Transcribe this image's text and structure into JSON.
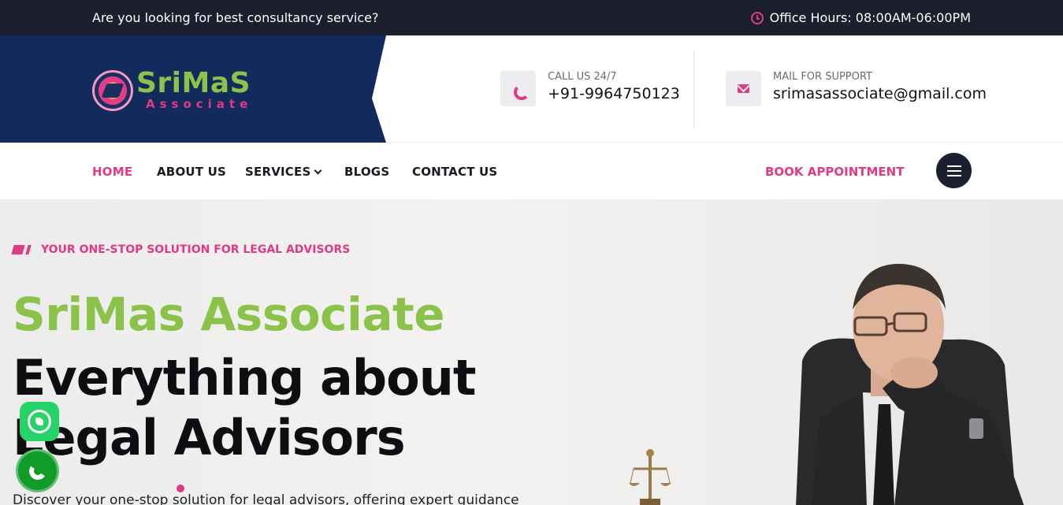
{
  "topbar": {
    "tagline": "Are you looking for best consultancy service?",
    "hours": "Office Hours: 08:00AM-06:00PM",
    "hours_icon": "clock-icon"
  },
  "brand": {
    "name": "SriMaS",
    "sub": "Associate",
    "panel_color": "#132a5c"
  },
  "contacts": {
    "phone": {
      "label": "CALL US 24/7",
      "value": "+91-9964750123",
      "icon": "phone-icon"
    },
    "mail": {
      "label": "MAIL FOR SUPPORT",
      "value": "srimasassociate@gmail.com",
      "icon": "mail-icon"
    }
  },
  "nav": {
    "items": [
      {
        "label": "HOME",
        "active": true
      },
      {
        "label": "ABOUT US"
      },
      {
        "label": "SERVICES",
        "dropdown": true
      },
      {
        "label": "BLOGS"
      },
      {
        "label": "CONTACT US"
      }
    ],
    "cta": "BOOK APPOINTMENT",
    "menu_icon": "hamburger-icon"
  },
  "hero": {
    "eyebrow": "YOUR ONE-STOP SOLUTION FOR LEGAL ADVISORS",
    "title_green": "SriMas Associate",
    "title_line1": "Everything about",
    "title_line2": "Legal Advisors",
    "description": "Discover your one-stop solution for legal advisors, offering expert guidance"
  },
  "floating": {
    "whatsapp_icon": "whatsapp-icon",
    "call_icon": "phone-icon"
  },
  "colors": {
    "accent_pink": "#e13a84",
    "accent_green": "#8bc34a",
    "dark": "#1c1f2e"
  }
}
